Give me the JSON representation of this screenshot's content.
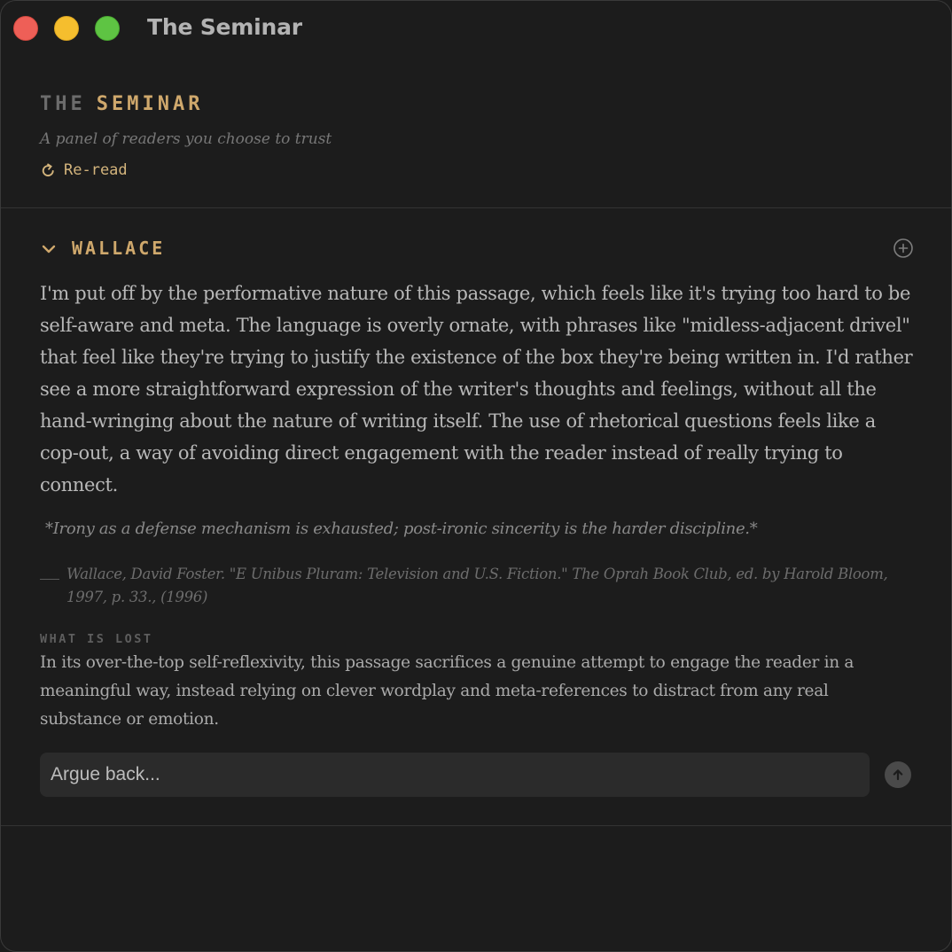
{
  "window": {
    "title": "The Seminar"
  },
  "header": {
    "brand_the": "THE",
    "brand_name": "SEMINAR",
    "tagline": "A panel of readers you choose to trust",
    "reread_label": "Re-read"
  },
  "panel": {
    "reader": "WALLACE",
    "critique": "I'm put off by the performative nature of this passage, which feels like it's trying too hard to be self-aware and meta. The language is overly ornate, with phrases like \"midless-adjacent drivel\" that feel like they're trying to justify the existence of the box they're being written in. I'd rather see a more straightforward expression of the writer's thoughts and feelings, without all the hand-wringing about the nature of writing itself. The use of rhetorical questions feels like a cop-out, a way of avoiding direct engagement with the reader instead of really trying to connect.",
    "quote": "*Irony as a defense mechanism is exhausted; post-ironic sincerity is the harder discipline.*",
    "citation": "Wallace, David Foster. \"E Unibus Pluram: Television and U.S. Fiction.\" The Oprah Book Club, ed. by Harold Bloom, 1997, p. 33., (1996)",
    "lost_label": "WHAT IS LOST",
    "lost_text": " In its over-the-top self-reflexivity, this passage sacrifices a genuine attempt to engage the reader in a meaningful way, instead relying on clever wordplay and meta-references to distract from any real substance or emotion.",
    "reply_placeholder": "Argue back..."
  },
  "colors": {
    "accent": "#cfa86c",
    "background": "#1c1c1c",
    "input_bg": "#2b2b2b"
  },
  "icons": {
    "reread": "refresh-icon",
    "collapse": "chevron-down-icon",
    "add": "plus-circle-icon",
    "send": "arrow-up-icon"
  }
}
